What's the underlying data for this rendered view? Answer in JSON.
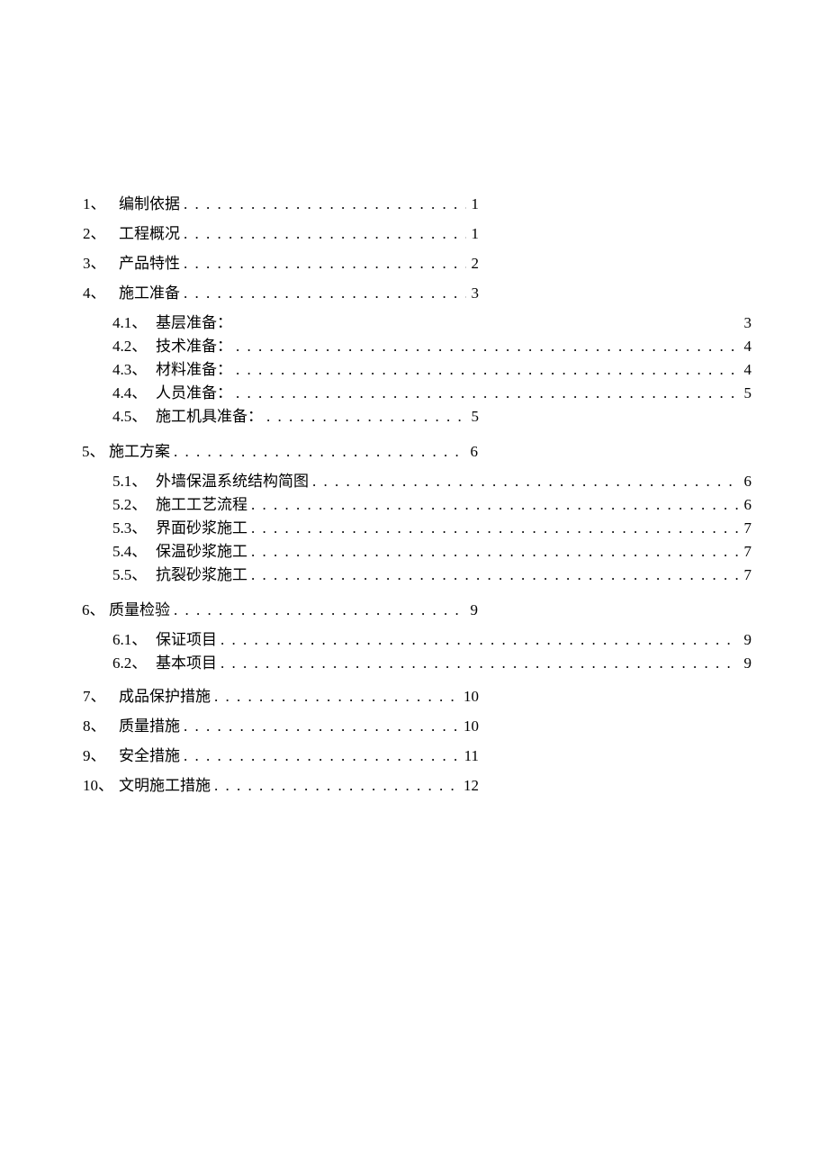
{
  "toc": {
    "entries": [
      {
        "level": 1,
        "num": "1、",
        "title": "编制依据",
        "page": "1",
        "width": "short"
      },
      {
        "level": 1,
        "num": "2、",
        "title": "工程概况",
        "page": "1",
        "width": "short"
      },
      {
        "level": 1,
        "num": "3、",
        "title": "产品特性",
        "page": "2",
        "width": "short"
      },
      {
        "level": 1,
        "num": "4、",
        "title": "施工准备",
        "page": "3",
        "width": "short"
      },
      {
        "level": 2,
        "num": "4.1、",
        "title": "基层准备：",
        "page": "3",
        "nodots": true
      },
      {
        "level": 2,
        "num": "4.2、",
        "title": "技术准备：",
        "page": "4"
      },
      {
        "level": 2,
        "num": "4.3、",
        "title": "材料准备：",
        "page": "4"
      },
      {
        "level": 2,
        "num": "4.4、",
        "title": "人员准备：",
        "page": "5"
      },
      {
        "level": 2,
        "num": "4.5、",
        "title": "施工机具准备：",
        "page": "5",
        "width": "short"
      },
      {
        "level": 1,
        "num": "5、",
        "title": "施工方案",
        "page": "6",
        "width": "short",
        "section": "5"
      },
      {
        "level": 2,
        "num": "5.1、",
        "title": "外墙保温系统结构简图",
        "page": "6"
      },
      {
        "level": 2,
        "num": "5.2、",
        "title": "施工工艺流程",
        "page": "6"
      },
      {
        "level": 2,
        "num": "5.3、",
        "title": "界面砂浆施工",
        "page": "7"
      },
      {
        "level": 2,
        "num": "5.4、",
        "title": "保温砂浆施工",
        "page": "7"
      },
      {
        "level": 2,
        "num": "5.5、",
        "title": "抗裂砂浆施工",
        "page": "7"
      },
      {
        "level": 1,
        "num": "6、",
        "title": "质量检验",
        "page": "9",
        "width": "short",
        "section": "6"
      },
      {
        "level": 2,
        "num": "6.1、",
        "title": "保证项目",
        "page": "9"
      },
      {
        "level": 2,
        "num": "6.2、",
        "title": "基本项目",
        "page": "9"
      },
      {
        "level": 1,
        "num": "7、",
        "title": "成品保护措施",
        "page": "10",
        "width": "short"
      },
      {
        "level": 1,
        "num": "8、",
        "title": "质量措施",
        "page": "10",
        "width": "short"
      },
      {
        "level": 1,
        "num": "9、",
        "title": "安全措施",
        "page": "11",
        "width": "short"
      },
      {
        "level": 1,
        "num": "10、",
        "title": "文明施工措施",
        "page": "12",
        "width": "short"
      }
    ],
    "dots_short": ". . . . . . . . . . . . . . . . . . . . . . . . . . . . . . . . . . .",
    "dots_long": ". . . . . . . . . . . . . . . . . . . . . . . . . . . . . . . . . . . . . . . . . . . . . . . . . . . . . . . . . . . . . . . . . . . . . . . . . . . . . . ."
  }
}
